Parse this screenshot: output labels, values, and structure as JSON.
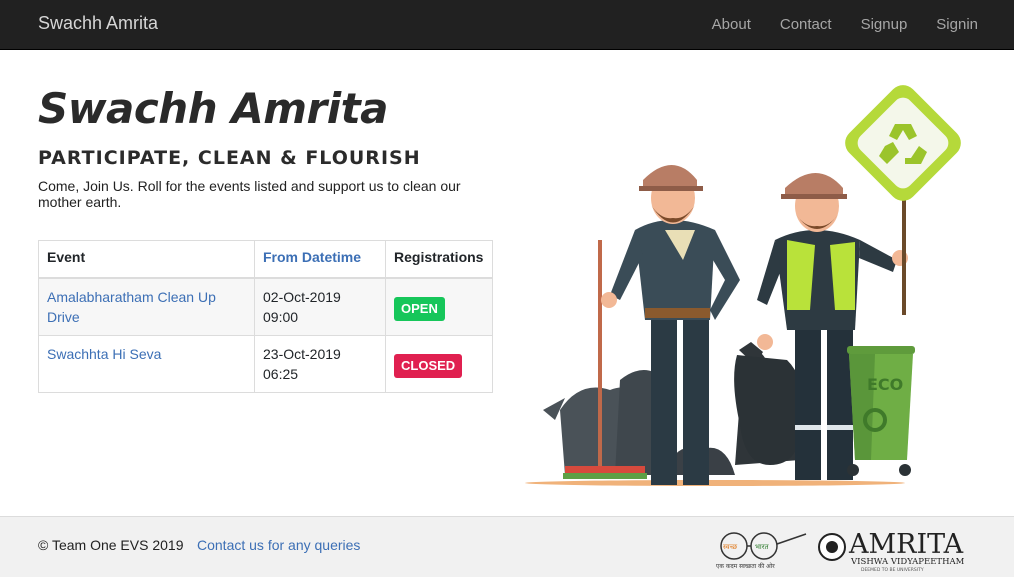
{
  "nav": {
    "brand": "Swachh Amrita",
    "links": [
      "About",
      "Contact",
      "Signup",
      "Signin"
    ]
  },
  "hero": {
    "title": "Swachh Amrita",
    "subtitle": "PARTICIPATE, CLEAN & FLOURISH",
    "lead": "Come, Join Us. Roll for the events listed and support us to clean our mother earth."
  },
  "table": {
    "headers": [
      "Event",
      "From Datetime",
      "Registrations"
    ],
    "rows": [
      {
        "event": "Amalabharatham Clean Up Drive",
        "date": "02-Oct-2019",
        "time": "09:00",
        "status": "OPEN",
        "status_color": "#16c65a"
      },
      {
        "event": "Swachhta Hi Seva",
        "date": "23-Oct-2019",
        "time": "06:25",
        "status": "CLOSED",
        "status_color": "#e02050"
      }
    ]
  },
  "illustration": {
    "sign_icon": "recycle-icon",
    "bin_label": "ECO"
  },
  "footer": {
    "copyright": "© Team One EVS 2019",
    "contact_link": "Contact us for any queries",
    "swachh_logo": {
      "left_text": "स्वच्छ",
      "right_text": "भारत",
      "caption": "एक कदम स्वच्छता की ओर"
    },
    "amrita_logo": {
      "main": "AMRITA",
      "sub": "VISHWA VIDYAPEETHAM",
      "tag": "DEEMED TO BE UNIVERSITY"
    }
  },
  "colors": {
    "navbar": "#212121",
    "link": "#3c6fb5",
    "open": "#16c65a",
    "closed": "#e02050"
  }
}
